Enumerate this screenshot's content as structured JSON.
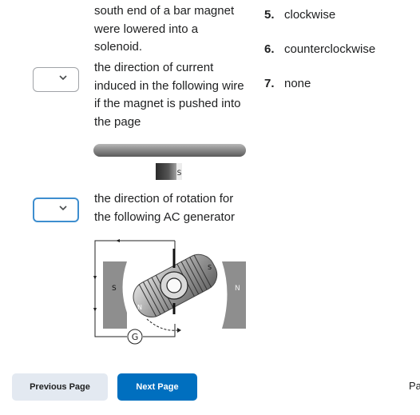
{
  "questions": [
    {
      "text": "south end of a bar magnet were lowered into a solenoid."
    },
    {
      "text": "the direction of current induced in the following wire if the magnet is pushed into the page"
    },
    {
      "text": "the direction of rotation for the following AC generator"
    }
  ],
  "figures": {
    "magnet_label": "S",
    "generator": {
      "left_pole": "S",
      "right_pole": "N",
      "coil_near": "N",
      "coil_far": "S",
      "galvanometer": "G"
    }
  },
  "answers": [
    {
      "num": "5.",
      "label": "clockwise"
    },
    {
      "num": "6.",
      "label": "counterclockwise"
    },
    {
      "num": "7.",
      "label": "none"
    }
  ],
  "nav": {
    "prev_label": "Previous Page",
    "next_label": "Next Page",
    "page_label": "Pa"
  },
  "colors": {
    "accent": "#006fbf",
    "focus_border": "#3e8ecf",
    "prev_bg": "#e3e9f1"
  }
}
